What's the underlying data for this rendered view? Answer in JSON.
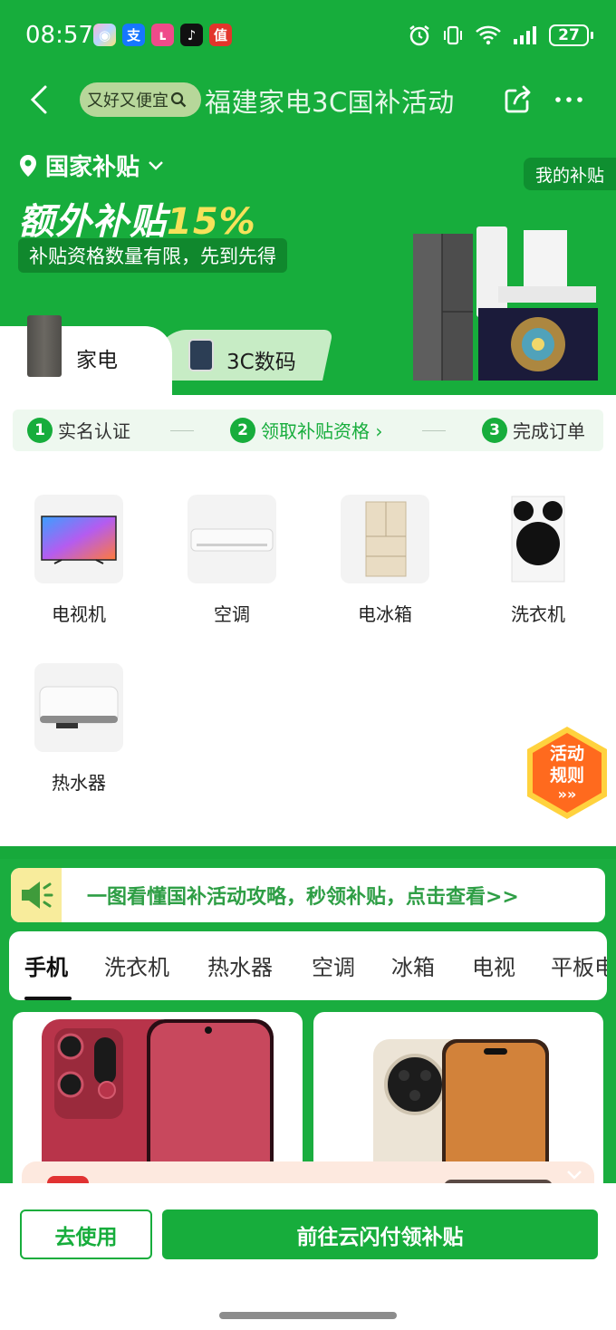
{
  "status_bar": {
    "time": "08:57",
    "battery": "27",
    "app_icons": [
      {
        "name": "photos-app-icon",
        "glyph": "◉",
        "color": "#f4a9d0"
      },
      {
        "name": "alipay-app-icon",
        "glyph": "支",
        "color": "#1677ff"
      },
      {
        "name": "video-app-icon",
        "glyph": "ʟ",
        "color": "#ef4b8a"
      },
      {
        "name": "douyin-app-icon",
        "glyph": "♪",
        "color": "#111111"
      },
      {
        "name": "smzdm-app-icon",
        "glyph": "值",
        "color": "#e2352b"
      }
    ]
  },
  "nav": {
    "search_text": "又好又便宜",
    "title": "福建家电3C国补活动"
  },
  "header": {
    "location": "国家补贴",
    "my_subsidy": "我的补贴",
    "headline_text": "额外补贴",
    "headline_pct": "15%",
    "badge": "补贴资格数量有限，先到先得"
  },
  "tabs": {
    "appliances": "家电",
    "digital": "3C数码"
  },
  "steps": [
    {
      "num": "1",
      "label": "实名认证"
    },
    {
      "num": "2",
      "label": "领取补贴资格 ›"
    },
    {
      "num": "3",
      "label": "完成订单"
    }
  ],
  "categories": [
    {
      "label": "电视机"
    },
    {
      "label": "空调"
    },
    {
      "label": "电冰箱"
    },
    {
      "label": "洗衣机"
    },
    {
      "label": "热水器"
    }
  ],
  "rules_badge": {
    "line1": "活动",
    "line2": "规则",
    "arrows": "»»"
  },
  "guide": {
    "text": "一图看懂国补活动攻略，秒领补贴，点击查看>>"
  },
  "product_tabs": [
    "手机",
    "洗衣机",
    "热水器",
    "空调",
    "冰箱",
    "电视",
    "平板电脑"
  ],
  "buttons": {
    "use": "去使用",
    "go": "前往云闪付领补贴"
  },
  "colors": {
    "brand_green": "#17ad3c",
    "dark_green": "#0f8f30",
    "highlight_yellow": "#f6e25a",
    "rules_orange": "#ff6a1e"
  }
}
